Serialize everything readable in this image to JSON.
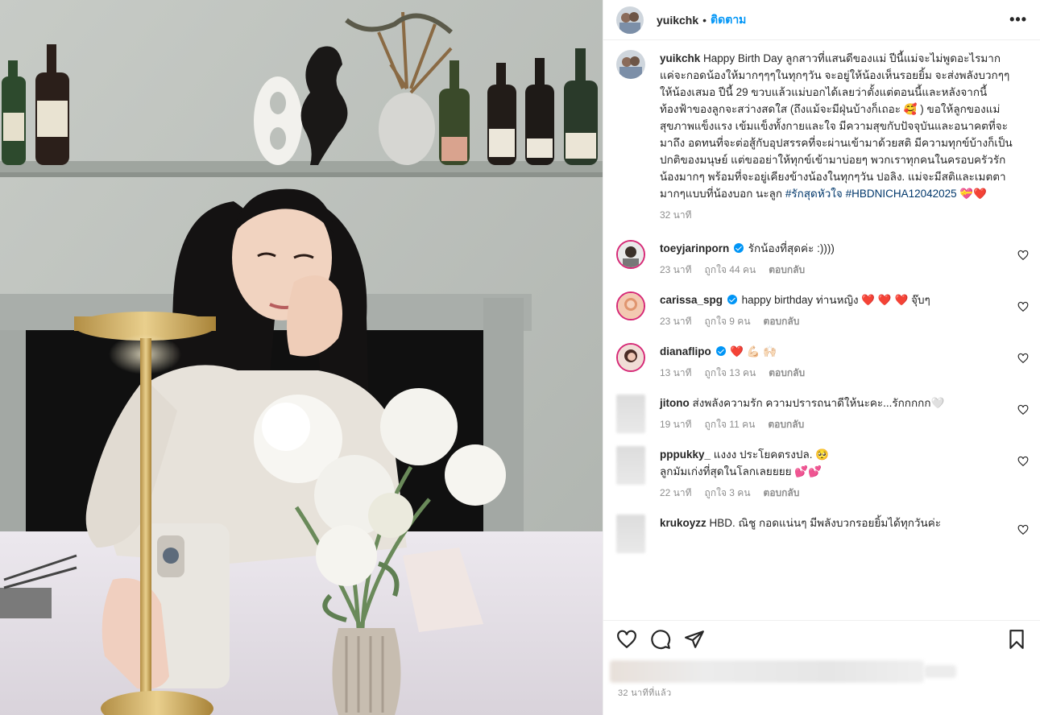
{
  "post": {
    "username": "yuikchk",
    "dot": "•",
    "follow_label": "ติดตาม",
    "more_label": "•••"
  },
  "caption": {
    "username": "yuikchk",
    "text": "Happy Birth Day ลูกสาวที่แสนดีของแม่ ปีนี้แม่จะไม่พูดอะไรมาก แค่จะกอดน้องให้มากๆๆๆในทุกๆวัน จะอยู่ให้น้องเห็นรอยยิ้ม จะส่งพลังบวกๆๆให้น้องเสมอ ปีนี้ 29 ขวบแล้วแม่บอกได้เลยว่าตั้งแต่ตอนนี้และหลังจากนี้ท้องฟ้าของลูกจะสว่างสดใส (ถึงแม้จะมีฝุ่นบ้างก็เถอะ 🥰 ) ขอให้ลูกของแม่สุขภาพแข็งแรง เข้มแข็งทั้งกายและใจ มีความสุขกับปัจจุบันและอนาคตที่จะมาถึง อดทนที่จะต่อสู้กับอุปสรรคที่จะผ่านเข้ามาด้วยสติ มีความทุกข์บ้างก็เป็นปกติของมนุษย์ แต่ขออย่าให้ทุกข์เข้ามาบ่อยๆ พวกเราทุกคนในครอบครัวรักน้องมากๆ พร้อมที่จะอยู่เคียงข้างน้องในทุกๆวัน ปอลิง. แม่จะมีสติและเมตตามากๆแบบที่น้องบอก นะลูก",
    "hashtag1": "#รักสุดหัวใจ",
    "hashtag2": "#HBDNICHA12042025",
    "emoji_end": "💝❤️",
    "time": "32 นาที"
  },
  "comments": [
    {
      "username": "toeyjarinporn",
      "verified": true,
      "text": "รักน้องที่สุดค่ะ :))))",
      "time": "23 นาที",
      "likes": "ถูกใจ 44 คน",
      "reply": "ตอบกลับ"
    },
    {
      "username": "carissa_spg",
      "verified": true,
      "text": "happy birthday ท่านหญิง ❤️ ❤️ ❤️  จุ๊บๆ",
      "time": "23 นาที",
      "likes": "ถูกใจ 9 คน",
      "reply": "ตอบกลับ"
    },
    {
      "username": "dianaflipo",
      "verified": true,
      "text": "❤️ 💪🏻 🙌🏻",
      "time": "13 นาที",
      "likes": "ถูกใจ 13 คน",
      "reply": "ตอบกลับ"
    },
    {
      "username": "jitono",
      "verified": false,
      "text": "ส่งพลังความรัก ความปรารถนาดีให้นะคะ...รักกกกก🤍",
      "time": "19 นาที",
      "likes": "ถูกใจ 11 คน",
      "reply": "ตอบกลับ"
    },
    {
      "username": "pppukky_",
      "verified": false,
      "text": "แงงง ประโยคตรงปล. 🥺",
      "text2": "ลูกมัมเก่งที่สุดในโลกเลยยยย 💕💕",
      "time": "22 นาที",
      "likes": "ถูกใจ 3 คน",
      "reply": "ตอบกลับ"
    },
    {
      "username": "krukoyzz",
      "verified": false,
      "text": "HBD. ณิชู กอดแน่นๆ มีพลังบวกรอยยิ้มได้ทุกวันค่ะ"
    }
  ],
  "footer": {
    "time": "32 นาทีที่แล้ว"
  },
  "icons": {
    "like": "heart-icon",
    "comment": "comment-icon",
    "share": "share-icon",
    "save": "bookmark-icon"
  },
  "colors": {
    "link_blue": "#0095f6",
    "hashtag": "#00376b",
    "muted": "#8e8e8e",
    "heart_red": "#ed4956"
  }
}
